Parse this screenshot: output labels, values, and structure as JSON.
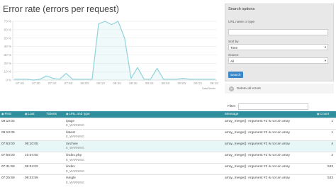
{
  "page_title": "Error rate (errors per request)",
  "chart_data": {
    "type": "area",
    "title": "Error rate (errors per request)",
    "x": [
      "07:20",
      "07:25",
      "07:30",
      "07:35",
      "07:40",
      "07:45",
      "07:50",
      "07:55",
      "08:00",
      "08:05",
      "08:10",
      "08:15",
      "08:20",
      "08:25",
      "08:30",
      "08:35",
      "08:40",
      "08:45",
      "08:50",
      "08:55",
      "09:00",
      "09:05",
      "09:10",
      "09:15"
    ],
    "x_ticks": [
      "07:20",
      "07:30",
      "07:40",
      "07:50",
      "08:00",
      "08:10",
      "08:20",
      "08:30",
      "08:40",
      "08:50",
      "09:00",
      "09:10",
      "09:15"
    ],
    "y_ticks": [
      "0 %",
      "10 %",
      "20 %",
      "30 %",
      "40 %",
      "50 %",
      "60 %",
      "70 %"
    ],
    "series": [
      {
        "values": [
          1,
          1,
          1,
          0,
          1,
          5,
          2,
          1,
          8,
          1,
          1,
          1,
          1,
          67,
          70,
          66,
          70,
          50,
          2,
          15,
          1,
          1,
          14,
          1,
          1,
          1,
          2,
          1,
          1,
          1,
          1,
          1
        ]
      }
    ],
    "ylim": [
      0,
      70
    ],
    "grid": true,
    "line_color": "#8fd3dc",
    "credit": "Data Studio"
  },
  "search": {
    "title": "Search options",
    "url_label": "URL name or type",
    "url_value": "",
    "sort_label": "Sort by",
    "sort_value": "Time",
    "source_label": "Source",
    "source_value": "All",
    "button": "Search"
  },
  "delete_all_label": "Delete all errors",
  "filter_label": "Filter:",
  "table": {
    "headers": {
      "first": "First",
      "last": "Last",
      "tickets": "Tickets",
      "url": "URL and type",
      "message": "Message",
      "count": "Count"
    },
    "rows": [
      {
        "first": "09:10:03",
        "last": "",
        "tickets": "",
        "url": "/page",
        "type": "E_WARNING",
        "message": "array_merge(): Argument #2 is not an array",
        "count": "1"
      },
      {
        "first": "09:10:05",
        "last": "",
        "tickets": "",
        "url": "/latest",
        "type": "E_WARNING",
        "message": "array_merge(): Argument #2 is not an array",
        "count": "1"
      },
      {
        "first": "07:53:00",
        "last": "09:10:05",
        "tickets": "",
        "url": "/archive",
        "type": "E_WARNING",
        "message": "array_merge(): Argument #2 is not an array",
        "count": "4"
      },
      {
        "first": "07:50:00",
        "last": "10:04:00",
        "tickets": "",
        "url": "/index.php",
        "type": "E_WARNING",
        "message": "array_merge(): Argument #2 is not an array",
        "count": "2"
      },
      {
        "first": "07:31:59",
        "last": "09:34:02",
        "tickets": "",
        "url": "/index",
        "type": "E_WARNING",
        "message": "array_merge(): Argument #2 is not an array",
        "count": "533"
      },
      {
        "first": "07:25:59",
        "last": "09:33:59",
        "tickets": "",
        "url": "/single",
        "type": "E_WARNING",
        "message": "array_merge(): Argument #2 is not an array",
        "count": "533"
      }
    ]
  }
}
